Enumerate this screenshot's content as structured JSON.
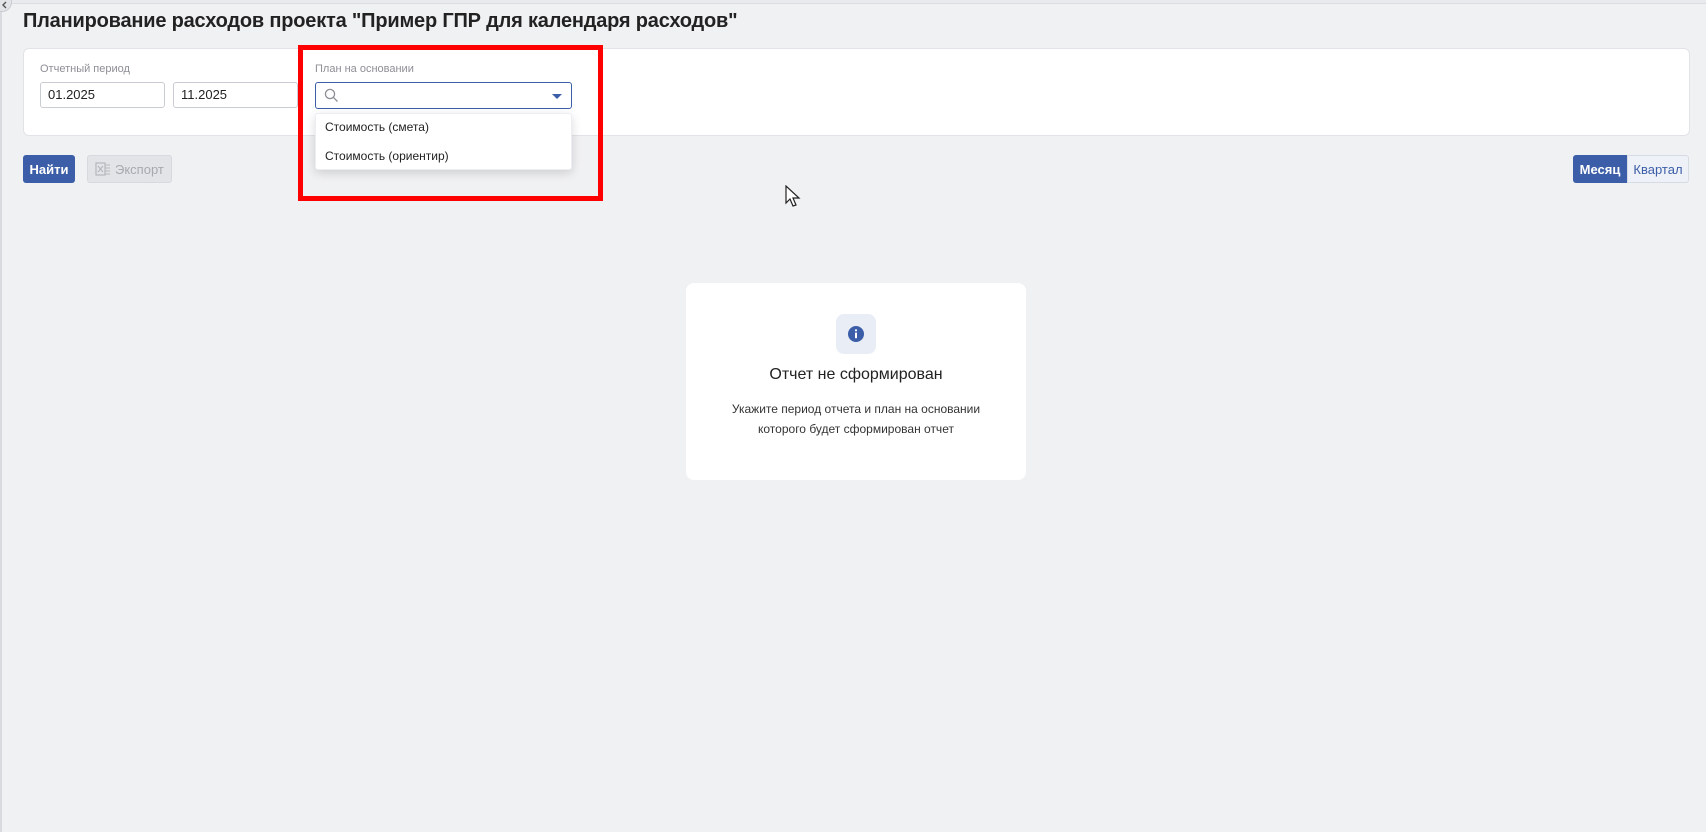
{
  "page": {
    "title": "Планирование расходов проекта \"Пример ГПР для календаря расходов\""
  },
  "filters": {
    "period_label": "Отчетный период",
    "period_from": "01.2025",
    "period_to": "11.2025",
    "plan_label": "План на основании",
    "plan_value": "",
    "plan_options": [
      "Стоимость (смета)",
      "Стоимость (ориентир)"
    ]
  },
  "toolbar": {
    "find_label": "Найти",
    "export_label": "Экспорт",
    "month_label": "Месяц",
    "quarter_label": "Квартал",
    "selected_view": "Месяц"
  },
  "empty_state": {
    "title": "Отчет не сформирован",
    "line1": "Укажите период отчета и план на основании",
    "line2": "которого будет сформирован отчет"
  },
  "colors": {
    "accent": "#3c5ea8",
    "highlight": "#ff0000",
    "background": "#f0f1f3"
  }
}
